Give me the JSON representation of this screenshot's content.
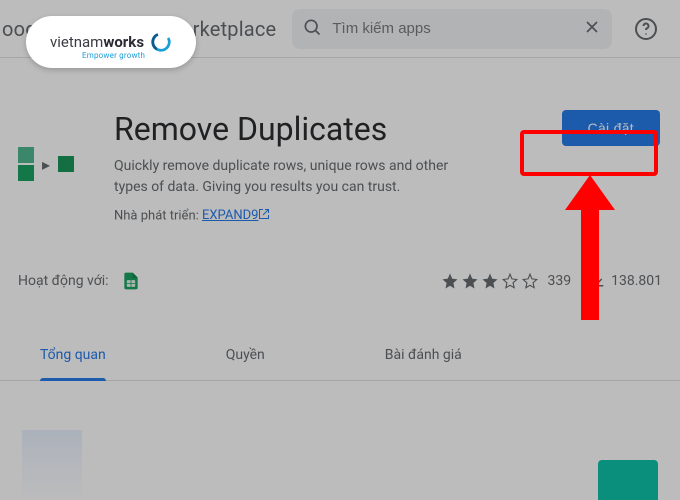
{
  "topbar": {
    "brand_partial": "oogle Workspace Marketplace",
    "search_placeholder": "Tìm kiếm apps"
  },
  "logo": {
    "text_plain": "vietnam",
    "text_bold": "works",
    "tagline": "Empower growth"
  },
  "app": {
    "title": "Remove Duplicates",
    "description": "Quickly remove duplicate rows, unique rows and other types of data. Giving you results you can trust.",
    "developer_label": "Nhà phát triển:",
    "developer_name": "EXPAND9"
  },
  "install": {
    "label": "Cài đặt"
  },
  "stats": {
    "works_with_label": "Hoạt động với:",
    "rating_count": "339",
    "stars_filled": 3,
    "download_count": "138.801"
  },
  "tabs": {
    "overview": "Tổng quan",
    "permissions": "Quyền",
    "reviews": "Bài đánh giá"
  }
}
